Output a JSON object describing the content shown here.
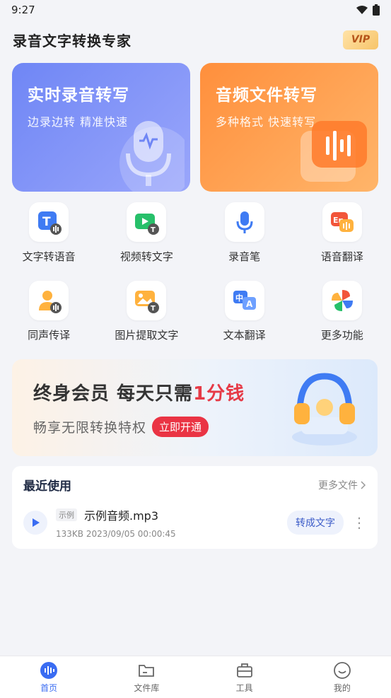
{
  "status_bar": {
    "time": "9:27"
  },
  "header": {
    "title": "录音文字转换专家",
    "vip_label": "VIP"
  },
  "hero_cards": [
    {
      "title": "实时录音转写",
      "subtitle": "边录边转 精准快速",
      "icon": "microphone-icon"
    },
    {
      "title": "音频文件转写",
      "subtitle": "多种格式 快速转写",
      "icon": "audio-file-icon"
    }
  ],
  "features": [
    {
      "label": "文字转语音",
      "icon": "text-to-speech-icon"
    },
    {
      "label": "视频转文字",
      "icon": "video-to-text-icon"
    },
    {
      "label": "录音笔",
      "icon": "microphone-icon"
    },
    {
      "label": "语音翻译",
      "icon": "voice-translate-icon"
    },
    {
      "label": "同声传译",
      "icon": "simultaneous-interpret-icon"
    },
    {
      "label": "图片提取文字",
      "icon": "image-text-icon"
    },
    {
      "label": "文本翻译",
      "icon": "text-translate-icon"
    },
    {
      "label": "更多功能",
      "icon": "more-features-icon"
    }
  ],
  "banner": {
    "title_prefix": "终身会员  每天只需",
    "title_accent": "1分钱",
    "subtitle": "畅享无限转换特权",
    "cta": "立即开通"
  },
  "recent": {
    "title": "最近使用",
    "more": "更多文件",
    "file": {
      "tag": "示例",
      "name": "示例音频.mp3",
      "meta": "133KB 2023/09/05 00:00:45",
      "action": "转成文字"
    }
  },
  "bottom_nav": [
    {
      "label": "首页",
      "icon": "home-waveform-icon",
      "active": true
    },
    {
      "label": "文件库",
      "icon": "folder-icon",
      "active": false
    },
    {
      "label": "工具",
      "icon": "toolbox-icon",
      "active": false
    },
    {
      "label": "我的",
      "icon": "profile-smile-icon",
      "active": false
    }
  ],
  "colors": {
    "primary": "#3a6cf2",
    "hero_blue": "#7a8ef7",
    "hero_orange": "#ff9a45",
    "accent_red": "#e63a46"
  }
}
